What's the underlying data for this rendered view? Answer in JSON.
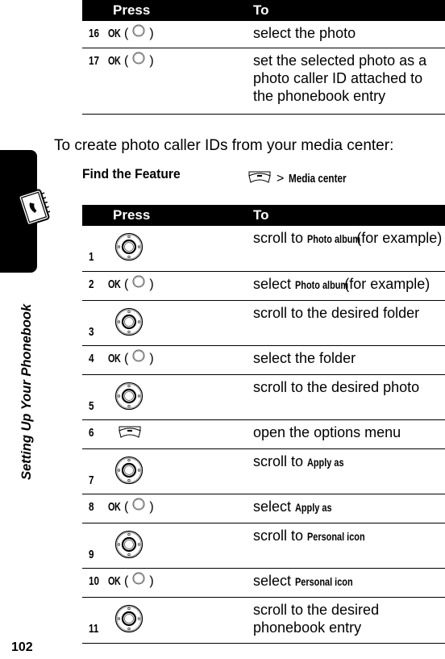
{
  "page": {
    "number": "102",
    "section_title": "Setting Up Your Phonebook"
  },
  "colors": {
    "header_bg": "#000000",
    "header_text": "#ffffff",
    "text": "#000000"
  },
  "table_top": {
    "headers": {
      "press": "Press",
      "to": "To"
    },
    "rows": [
      {
        "num": "16",
        "key": "OK",
        "key_icon": "center-select-icon",
        "to": [
          {
            "t": "select the photo"
          }
        ]
      },
      {
        "num": "17",
        "key": "OK",
        "key_icon": "center-select-icon",
        "to": [
          {
            "t": "set the selected photo as a photo caller ID attached to the phonebook entry"
          }
        ]
      }
    ]
  },
  "intro": "To create photo caller IDs from your media center:",
  "find_feature": {
    "label": "Find the Feature",
    "icon": "menu-key-icon",
    "separator": ">",
    "path": "Media center"
  },
  "table_main": {
    "headers": {
      "press": "Press",
      "to": "To"
    },
    "rows": [
      {
        "num": "1",
        "key_icon": "nav-key-icon",
        "to": [
          {
            "t": "scroll to "
          },
          {
            "b": "Photo album"
          },
          {
            "t": " (for example)"
          }
        ]
      },
      {
        "num": "2",
        "key": "OK",
        "key_icon": "center-select-icon",
        "to": [
          {
            "t": "select "
          },
          {
            "b": "Photo album"
          },
          {
            "t": " (for example)"
          }
        ]
      },
      {
        "num": "3",
        "key_icon": "nav-key-icon",
        "to": [
          {
            "t": "scroll to the desired folder"
          }
        ]
      },
      {
        "num": "4",
        "key": "OK",
        "key_icon": "center-select-icon",
        "to": [
          {
            "t": "select the folder"
          }
        ]
      },
      {
        "num": "5",
        "key_icon": "nav-key-icon",
        "to": [
          {
            "t": "scroll to the desired photo"
          }
        ]
      },
      {
        "num": "6",
        "key_icon": "menu-key-icon",
        "to": [
          {
            "t": "open the options menu"
          }
        ]
      },
      {
        "num": "7",
        "key_icon": "nav-key-icon",
        "to": [
          {
            "t": "scroll to "
          },
          {
            "b": "Apply as"
          }
        ]
      },
      {
        "num": "8",
        "key": "OK",
        "key_icon": "center-select-icon",
        "to": [
          {
            "t": "select "
          },
          {
            "b": "Apply as"
          }
        ]
      },
      {
        "num": "9",
        "key_icon": "nav-key-icon",
        "to": [
          {
            "t": "scroll to "
          },
          {
            "b": "Personal icon"
          }
        ]
      },
      {
        "num": "10",
        "key": "OK",
        "key_icon": "center-select-icon",
        "to": [
          {
            "t": "select "
          },
          {
            "b": "Personal icon"
          }
        ]
      },
      {
        "num": "11",
        "key_icon": "nav-key-icon",
        "to": [
          {
            "t": "scroll to the desired phonebook entry"
          }
        ]
      }
    ]
  }
}
